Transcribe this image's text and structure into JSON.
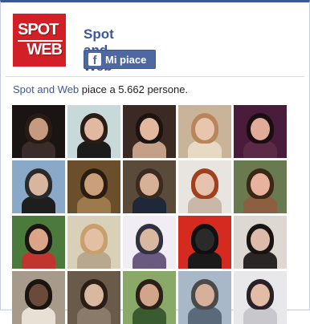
{
  "page": {
    "name": "Spot and Web",
    "logo_line1": "SPOT",
    "logo_line2": "WEB",
    "like_label": "Mi piace",
    "like_icon": "facebook-f-icon"
  },
  "likes": {
    "page_link": "Spot and Web",
    "text": " piace a 5.662 persone."
  },
  "fans": [
    {
      "bg": "#1a1512",
      "skin": "#c79a80",
      "hair": "#2a1a14",
      "shirt": "#3a2c2a"
    },
    {
      "bg": "#c7d9d8",
      "skin": "#e0b9a0",
      "hair": "#2a1d16",
      "shirt": "#1c1c1c"
    },
    {
      "bg": "#3b2a24",
      "skin": "#e3b8a0",
      "hair": "#1d1310",
      "shirt": "#c4a089"
    },
    {
      "bg": "#c9b49a",
      "skin": "#e7c6ad",
      "hair": "#b8865a",
      "shirt": "#e8d9c5"
    },
    {
      "bg": "#4a1c3c",
      "skin": "#e0ac98",
      "hair": "#1a0e12",
      "shirt": "#5a2a48"
    },
    {
      "bg": "#8aa9c8",
      "skin": "#d7b59e",
      "hair": "#2a2a2a",
      "shirt": "#1e1e1e"
    },
    {
      "bg": "#6b4f2c",
      "skin": "#caa07a",
      "hair": "#2a1c10",
      "shirt": "#9c7a4c"
    },
    {
      "bg": "#5a4a3a",
      "skin": "#d8b095",
      "hair": "#3a2a20",
      "shirt": "#1e2838"
    },
    {
      "bg": "#e8e4df",
      "skin": "#e6c3ae",
      "hair": "#a0401e",
      "shirt": "#c9b8a8"
    },
    {
      "bg": "#6a7a50",
      "skin": "#e8b29e",
      "hair": "#3a2814",
      "shirt": "#8a6040"
    },
    {
      "bg": "#4c7a3c",
      "skin": "#d9a488",
      "hair": "#1a1412",
      "shirt": "#c23430"
    },
    {
      "bg": "#d8d0b8",
      "skin": "#e3c0a4",
      "hair": "#c7a06c",
      "shirt": "#b8a890"
    },
    {
      "bg": "#f0eef4",
      "skin": "#d8b8a0",
      "hair": "#303040",
      "shirt": "#6a5a80"
    },
    {
      "bg": "#d42a20",
      "skin": "#2a2a2a",
      "hair": "#101010",
      "shirt": "#1a1a1a"
    },
    {
      "bg": "#ded8d2",
      "skin": "#dcbca8",
      "hair": "#181414",
      "shirt": "#2a2626"
    },
    {
      "bg": "#a89a8a",
      "skin": "#6a4a38",
      "hair": "#1a1410",
      "shirt": "#e8e0d4"
    },
    {
      "bg": "#6a5a4a",
      "skin": "#d9b8a0",
      "hair": "#2a1e16",
      "shirt": "#8a7a6a"
    },
    {
      "bg": "#8aa868",
      "skin": "#d2a48a",
      "hair": "#2a2018",
      "shirt": "#3a5a30"
    },
    {
      "bg": "#a8b8c8",
      "skin": "#d6b09a",
      "hair": "#4a4a4a",
      "shirt": "#5a6a7a"
    },
    {
      "bg": "#e8e8ea",
      "skin": "#e2bca6",
      "hair": "#2a2028",
      "shirt": "#c8c8cc"
    }
  ]
}
